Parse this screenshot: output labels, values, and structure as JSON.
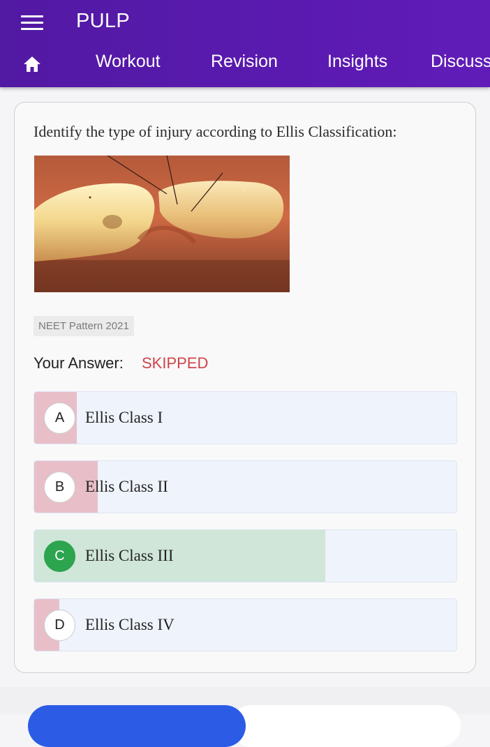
{
  "header": {
    "title": "PULP",
    "menu_icon": "hamburger-menu-icon",
    "home_icon": "home-icon",
    "tabs": [
      {
        "label": "Workout"
      },
      {
        "label": "Revision"
      },
      {
        "label": "Insights"
      },
      {
        "label": "Discuss"
      }
    ]
  },
  "question": {
    "text": "Identify the type of injury according to Ellis Classification:",
    "tag": "NEET Pattern 2021",
    "answer_label": "Your Answer:",
    "answer_status": "SKIPPED",
    "options": [
      {
        "letter": "A",
        "text": "Ellis Class I",
        "response_share": 0.1,
        "correct": false
      },
      {
        "letter": "B",
        "text": "Ellis Class II",
        "response_share": 0.15,
        "correct": false
      },
      {
        "letter": "C",
        "text": "Ellis Class III",
        "response_share": 0.69,
        "correct": true
      },
      {
        "letter": "D",
        "text": "Ellis Class IV",
        "response_share": 0.06,
        "correct": false
      }
    ]
  },
  "colors": {
    "header": "#5a1ab0",
    "skipped": "#d0434b",
    "wrong_fill": "#e8bfc8",
    "correct_fill": "#cfe6d8",
    "correct_badge": "#2da44e",
    "primary_button": "#2c5ce6"
  }
}
